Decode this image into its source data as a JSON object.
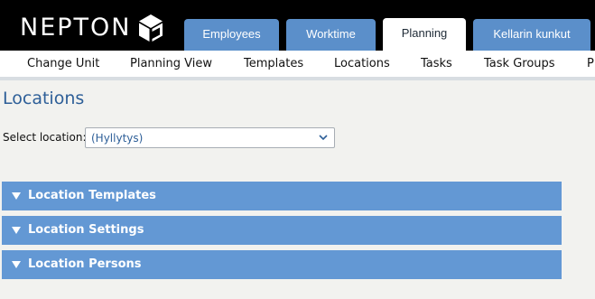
{
  "brand": {
    "logo_text": "NEPTON"
  },
  "colors": {
    "topbar": "#000000",
    "tab": "#5b8fca",
    "tab_active": "#ffffff",
    "panel": "#6398d4",
    "title": "#2e5f98",
    "page_bg": "#f2f2ef"
  },
  "tabs": [
    {
      "label": "Employees",
      "active": false
    },
    {
      "label": "Worktime",
      "active": false
    },
    {
      "label": "Planning",
      "active": true
    },
    {
      "label": "Kellarin kunkut",
      "active": false
    }
  ],
  "subnav": {
    "items": [
      {
        "label": "Change Unit"
      },
      {
        "label": "Planning View"
      },
      {
        "label": "Templates"
      },
      {
        "label": "Locations"
      },
      {
        "label": "Tasks"
      },
      {
        "label": "Task Groups"
      },
      {
        "label": "P"
      }
    ]
  },
  "page": {
    "title": "Locations"
  },
  "location_select": {
    "label": "Select location:",
    "value": "(Hyllytys)",
    "icon": "chevron-down-icon"
  },
  "panels": [
    {
      "label": "Location Templates",
      "icon": "triangle-down-icon"
    },
    {
      "label": "Location Settings",
      "icon": "triangle-down-icon"
    },
    {
      "label": "Location Persons",
      "icon": "triangle-down-icon"
    }
  ]
}
